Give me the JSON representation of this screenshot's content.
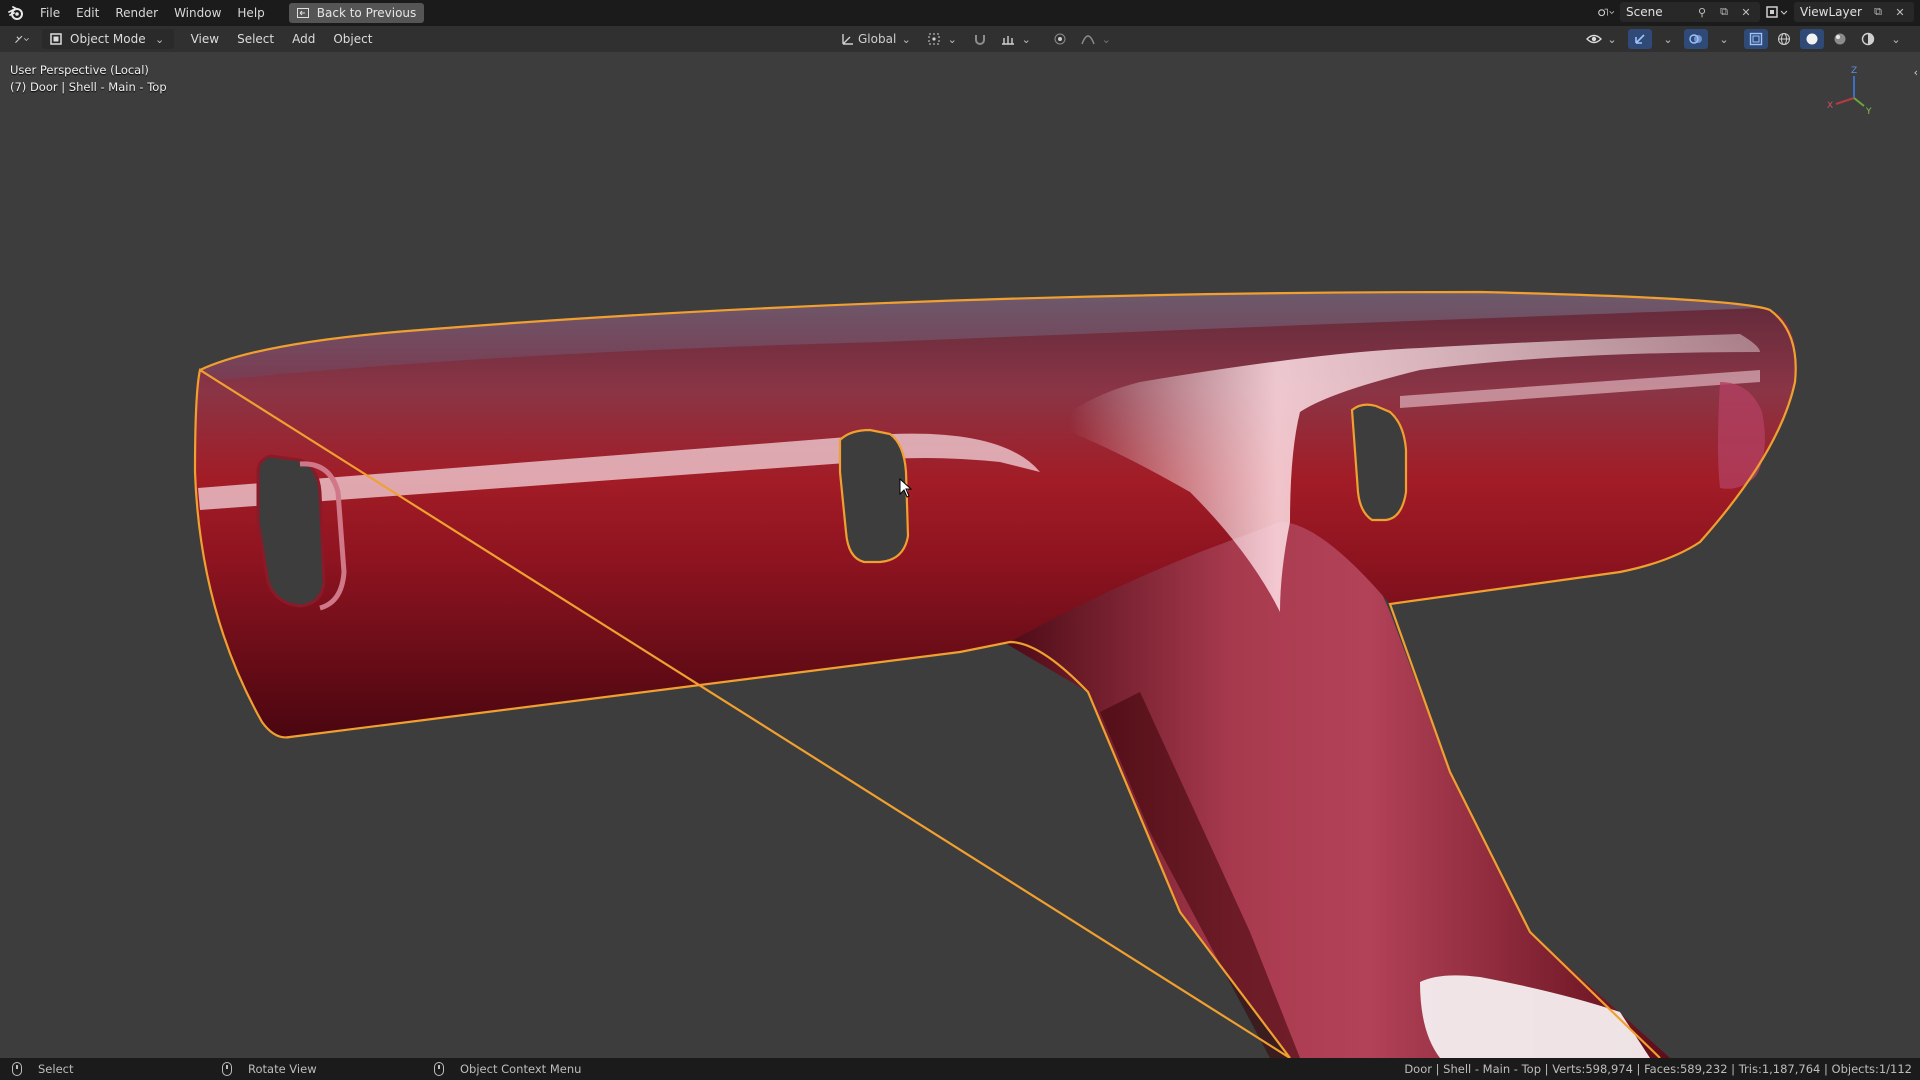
{
  "menubar": {
    "items": [
      "File",
      "Edit",
      "Render",
      "Window",
      "Help"
    ],
    "back_button": "Back to Previous",
    "scene": "Scene",
    "view_layer": "ViewLayer"
  },
  "viewport_header": {
    "mode": "Object Mode",
    "menus": [
      "View",
      "Select",
      "Add",
      "Object"
    ],
    "transform_orientation": "Global"
  },
  "viewport": {
    "perspective_label": "User Perspective (Local)",
    "object_label": "(7) Door | Shell - Main - Top",
    "gizmo_axes": [
      "Z",
      "X",
      "Y"
    ]
  },
  "statusbar": {
    "left_action": "Select",
    "middle_action": "Rotate View",
    "right_action": "Object Context Menu",
    "stats": "Door | Shell - Main - Top | Verts:598,974 | Faces:589,232 | Tris:1,187,764 | Objects:1/112"
  },
  "colors": {
    "selection_outline": "#f0a030",
    "object_red": "#9a1626",
    "viewport_bg": "#3d3d3d"
  },
  "icons": [
    "blender-logo-icon",
    "back-icon",
    "scene-icon",
    "pin-icon",
    "new-scene-icon",
    "close-icon",
    "viewlayer-icon",
    "editor-type-icon",
    "object-mode-icon",
    "transform-icon",
    "pivot-icon",
    "snap-icon",
    "proportional-icon",
    "visibility-icon",
    "gizmo-icon",
    "overlay-icon",
    "xray-icon",
    "shading-wireframe-icon",
    "shading-solid-icon",
    "shading-material-icon",
    "shading-rendered-icon",
    "mouse-icon"
  ]
}
